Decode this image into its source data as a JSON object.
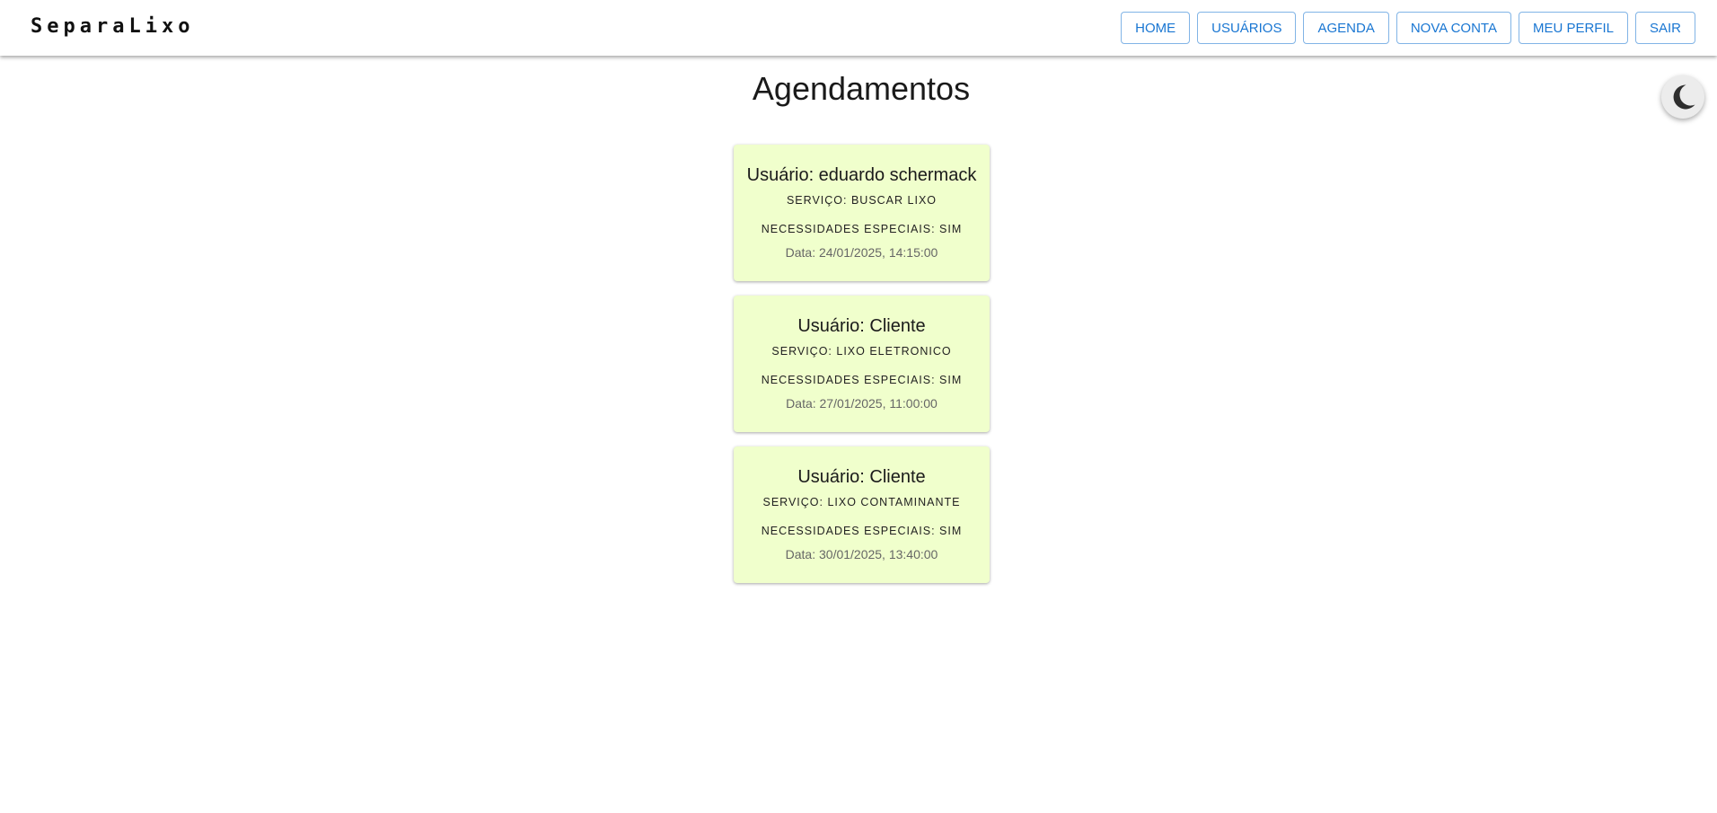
{
  "header": {
    "logo": "SeparaLixo",
    "nav": [
      "HOME",
      "USUÁRIOS",
      "AGENDA",
      "NOVA CONTA",
      "MEU PERFIL",
      "SAIR"
    ]
  },
  "theme_toggle": {
    "icon": "moon-icon"
  },
  "page": {
    "title": "Agendamentos"
  },
  "appointments": [
    {
      "user": "Usuário: eduardo schermack",
      "service": "Serviço: BUSCAR LIXO",
      "needs": "Necessidades Especiais: SIM",
      "date": "Data: 24/01/2025, 14:15:00"
    },
    {
      "user": "Usuário: Cliente",
      "service": "Serviço: LIXO ELETRONICO",
      "needs": "Necessidades Especiais: SIM",
      "date": "Data: 27/01/2025, 11:00:00"
    },
    {
      "user": "Usuário: Cliente",
      "service": "Serviço: LIXO CONTAMINANTE",
      "needs": "Necessidades Especiais: SIM",
      "date": "Data: 30/01/2025, 13:40:00"
    }
  ],
  "colors": {
    "accent": "#1976d2",
    "card_background": "#f0ffcc"
  }
}
